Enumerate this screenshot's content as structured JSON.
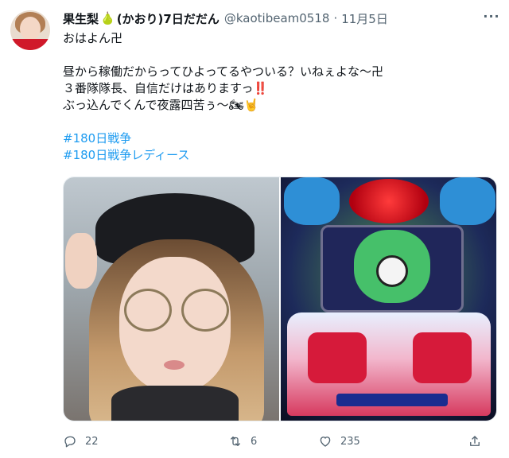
{
  "tweet": {
    "display_name": "果生梨",
    "display_name_pear_icon": "🍐",
    "display_name_suffix": "(かおり)7日だだん",
    "handle": "@kaotibeam0518",
    "separator": "·",
    "date": "11月5日",
    "more_label": "···",
    "text_lines": [
      "おはよん卍",
      "昼から稼働だからってひよってるやついる？いねぇよな〜卍",
      "３番隊隊長、自信だけはありますっ",
      "ぶっ込んでくんで夜露四苦ぅ〜"
    ],
    "emojis": {
      "double_exclamation": "‼️",
      "motorcycle": "🏍",
      "sign_of_horns": "🤘"
    },
    "hashtags": [
      "#180日戦争",
      "#180日戦争レディース"
    ],
    "media": {
      "photos": [
        "selfie-with-cap-and-glasses",
        "pachinko-machine-okinawa"
      ]
    },
    "stats": {
      "replies": "22",
      "retweets": "6",
      "likes": "235"
    }
  },
  "colors": {
    "text": "#0f1419",
    "secondary": "#536471",
    "link": "#1d9bf0"
  }
}
